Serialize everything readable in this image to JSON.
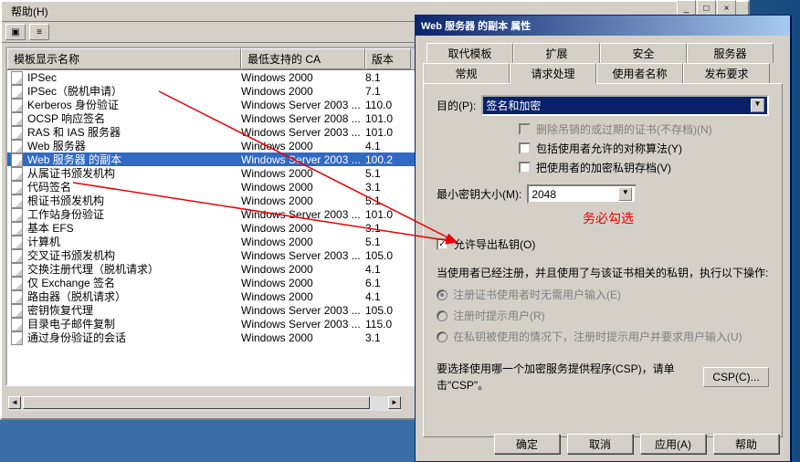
{
  "main_window": {
    "menu": {
      "help": "帮助(H)"
    },
    "columns": {
      "name": "模板显示名称",
      "ca": "最低支持的 CA",
      "version": "版本"
    },
    "rows": [
      {
        "name": "IPSec",
        "ca": "Windows 2000",
        "ver": "8.1"
      },
      {
        "name": "IPSec（脱机申请）",
        "ca": "Windows 2000",
        "ver": "7.1"
      },
      {
        "name": "Kerberos 身份验证",
        "ca": "Windows Server 2003 ...",
        "ver": "110.0"
      },
      {
        "name": "OCSP 响应签名",
        "ca": "Windows Server 2008 ...",
        "ver": "101.0"
      },
      {
        "name": "RAS 和 IAS 服务器",
        "ca": "Windows Server 2003 ...",
        "ver": "101.0"
      },
      {
        "name": "Web 服务器",
        "ca": "Windows 2000",
        "ver": "4.1"
      },
      {
        "name": "Web 服务器 的副本",
        "ca": "Windows Server 2003 ...",
        "ver": "100.2"
      },
      {
        "name": "从属证书颁发机构",
        "ca": "Windows 2000",
        "ver": "5.1"
      },
      {
        "name": "代码签名",
        "ca": "Windows 2000",
        "ver": "3.1"
      },
      {
        "name": "根证书颁发机构",
        "ca": "Windows 2000",
        "ver": "5.1"
      },
      {
        "name": "工作站身份验证",
        "ca": "Windows Server 2003 ...",
        "ver": "101.0"
      },
      {
        "name": "基本 EFS",
        "ca": "Windows 2000",
        "ver": "3.1"
      },
      {
        "name": "计算机",
        "ca": "Windows 2000",
        "ver": "5.1"
      },
      {
        "name": "交叉证书颁发机构",
        "ca": "Windows Server 2003 ...",
        "ver": "105.0"
      },
      {
        "name": "交换注册代理（脱机请求）",
        "ca": "Windows 2000",
        "ver": "4.1"
      },
      {
        "name": "仅 Exchange 签名",
        "ca": "Windows 2000",
        "ver": "6.1"
      },
      {
        "name": "路由器（脱机请求）",
        "ca": "Windows 2000",
        "ver": "4.1"
      },
      {
        "name": "密钥恢复代理",
        "ca": "Windows Server 2003 ...",
        "ver": "105.0"
      },
      {
        "name": "目录电子邮件复制",
        "ca": "Windows Server 2003 ...",
        "ver": "115.0"
      },
      {
        "name": "通过身份验证的会话",
        "ca": "Windows 2000",
        "ver": "3.1"
      }
    ],
    "selected_index": 6
  },
  "dialog": {
    "title": "Web 服务器 的副本 属性",
    "tabs_back": [
      "取代模板",
      "扩展",
      "安全",
      "服务器"
    ],
    "tabs_front": [
      "常规",
      "请求处理",
      "使用者名称",
      "发布要求"
    ],
    "active_tab": "请求处理",
    "purpose_label": "目的(P):",
    "purpose_value": "签名和加密",
    "cb_delete": "删除吊销的或过期的证书(不存档)(N)",
    "cb_include": "包括使用者允许的对称算法(Y)",
    "cb_archive": "把使用者的加密私钥存档(V)",
    "min_key_label": "最小密钥大小(M):",
    "min_key_value": "2048",
    "cb_export": "允许导出私钥(O)",
    "enrolled_text": "当使用者已经注册，并且使用了与该证书相关的私钥，执行以下操作:",
    "radio_no_input": "注册证书使用者时无需用户输入(E)",
    "radio_prompt": "注册时提示用户(R)",
    "radio_prompt_key": "在私钥被使用的情况下，注册时提示用户并要求用户输入(U)",
    "csp_text": "要选择使用哪一个加密服务提供程序(CSP)，请单击\"CSP\"。",
    "csp_button": "CSP(C)...",
    "buttons": {
      "ok": "确定",
      "cancel": "取消",
      "apply": "应用(A)",
      "help": "帮助"
    }
  },
  "annotation": "务必勾选"
}
